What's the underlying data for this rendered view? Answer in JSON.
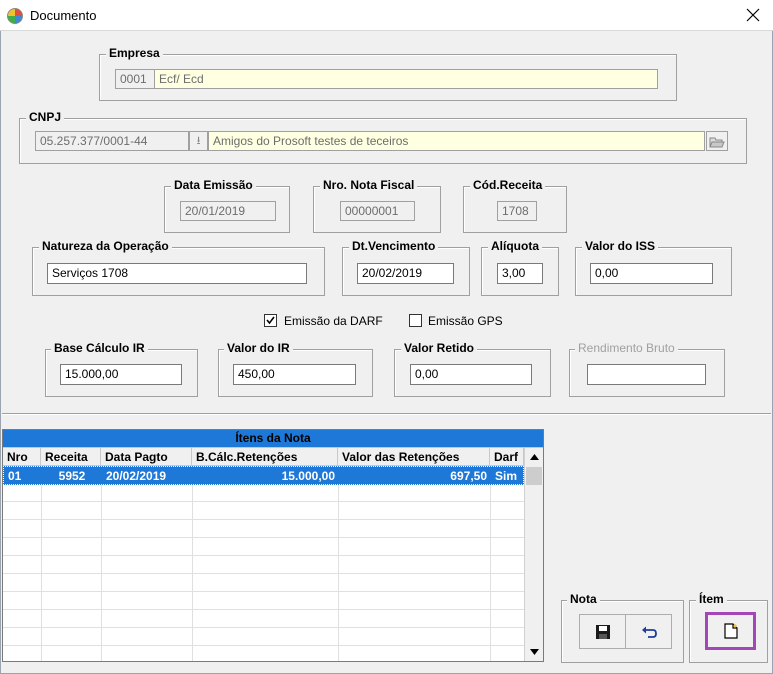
{
  "window": {
    "title": "Documento"
  },
  "empresa": {
    "legend": "Empresa",
    "code": "0001",
    "name": "Ecf/ Ecd"
  },
  "cnpj": {
    "legend": "CNPJ",
    "value": "05.257.377/0001-44",
    "name": "Amigos do Prosoft testes de teceiros"
  },
  "data_emissao": {
    "legend": "Data Emissão",
    "value": "20/01/2019"
  },
  "nro_nota": {
    "legend": "Nro. Nota Fiscal",
    "value": "00000001"
  },
  "cod_receita": {
    "legend": "Cód.Receita",
    "value": "1708"
  },
  "natureza": {
    "legend": "Natureza da Operação",
    "value": "Serviços 1708"
  },
  "dt_vencimento": {
    "legend": "Dt.Vencimento",
    "value": "20/02/2019"
  },
  "aliquota": {
    "legend": "Alíquota",
    "value": "3,00"
  },
  "valor_iss": {
    "legend": "Valor do ISS",
    "value": "0,00"
  },
  "checkboxes": {
    "darf_label": "Emissão da DARF",
    "darf_checked": true,
    "gps_label": "Emissão GPS",
    "gps_checked": false
  },
  "base_ir": {
    "legend": "Base Cálculo IR",
    "value": "15.000,00"
  },
  "valor_ir": {
    "legend": "Valor do IR",
    "value": "450,00"
  },
  "valor_retido": {
    "legend": "Valor Retido",
    "value": "0,00"
  },
  "rendimento_bruto": {
    "legend": "Rendimento Bruto",
    "value": ""
  },
  "grid": {
    "title": "Ítens da Nota",
    "columns": [
      "Nro",
      "Receita",
      "Data Pagto",
      "B.Cálc.Retenções",
      "Valor das Retenções",
      "Darf"
    ],
    "rows": [
      [
        "01",
        "5952",
        "20/02/2019",
        "15.000,00",
        "697,50",
        "Sim"
      ]
    ]
  },
  "nota_group": {
    "legend": "Nota",
    "save_icon": "save-icon",
    "undo_icon": "undo-icon"
  },
  "item_group": {
    "legend": "Ítem",
    "new_icon": "new-document-icon"
  },
  "colors": {
    "selection": "#1e78d7",
    "highlight_border": "#a347b8",
    "field_yellow": "#ffffe1"
  }
}
